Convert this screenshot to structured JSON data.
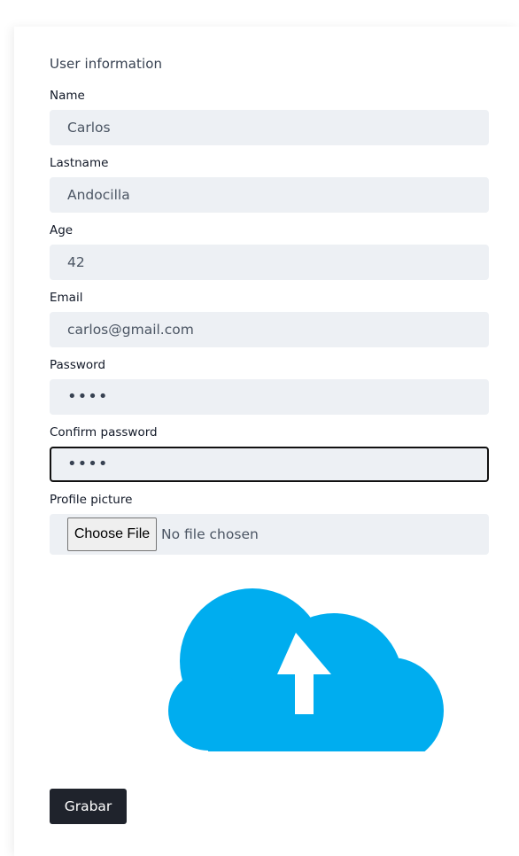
{
  "form": {
    "title": "User information",
    "fields": [
      {
        "label": "Name",
        "value": "Carlos",
        "type": "text"
      },
      {
        "label": "Lastname",
        "value": "Andocilla",
        "type": "text"
      },
      {
        "label": "Age",
        "value": "42",
        "type": "text"
      },
      {
        "label": "Email",
        "value": "carlos@gmail.com",
        "type": "text"
      },
      {
        "label": "Password",
        "value": "••••",
        "type": "password"
      },
      {
        "label": "Confirm password",
        "value": "••••",
        "type": "password",
        "focused": true
      }
    ],
    "profile_picture": {
      "label": "Profile picture",
      "button_label": "Choose File",
      "status": "No file chosen"
    },
    "upload_icon": "cloud-upload-icon",
    "submit_label": "Grabar"
  },
  "colors": {
    "input_bg": "#edf0f4",
    "cloud": "#00adef",
    "submit_bg": "#1f232c"
  }
}
